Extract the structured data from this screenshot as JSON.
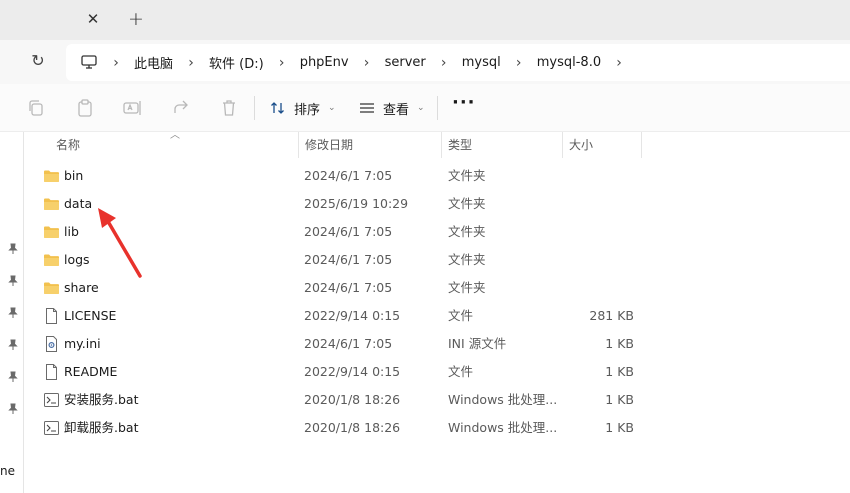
{
  "window": {
    "close_tab_glyph": "✕",
    "new_tab_glyph": "+"
  },
  "address_bar": {
    "refresh_glyph": "↻",
    "separator": "›",
    "crumbs": [
      "此电脑",
      "软件 (D:)",
      "phpEnv",
      "server",
      "mysql",
      "mysql-8.0"
    ]
  },
  "toolbar": {
    "sort_label": "排序",
    "view_label": "查看",
    "more_glyph": "···",
    "chevron": "⌄"
  },
  "nav_pane": {
    "partial_text": "ne"
  },
  "columns": {
    "name": "名称",
    "date": "修改日期",
    "type": "类型",
    "size": "大小"
  },
  "files": [
    {
      "icon": "folder-icon",
      "name": "bin",
      "date": "2024/6/1 7:05",
      "type": "文件夹",
      "size": ""
    },
    {
      "icon": "folder-icon",
      "name": "data",
      "date": "2025/6/19 10:29",
      "type": "文件夹",
      "size": ""
    },
    {
      "icon": "folder-icon",
      "name": "lib",
      "date": "2024/6/1 7:05",
      "type": "文件夹",
      "size": ""
    },
    {
      "icon": "folder-icon",
      "name": "logs",
      "date": "2024/6/1 7:05",
      "type": "文件夹",
      "size": ""
    },
    {
      "icon": "folder-icon",
      "name": "share",
      "date": "2024/6/1 7:05",
      "type": "文件夹",
      "size": ""
    },
    {
      "icon": "file-icon",
      "name": "LICENSE",
      "date": "2022/9/14 0:15",
      "type": "文件",
      "size": "281 KB"
    },
    {
      "icon": "ini-file-icon",
      "name": "my.ini",
      "date": "2024/6/1 7:05",
      "type": "INI 源文件",
      "size": "1 KB"
    },
    {
      "icon": "file-icon",
      "name": "README",
      "date": "2022/9/14 0:15",
      "type": "文件",
      "size": "1 KB"
    },
    {
      "icon": "batch-file-icon",
      "name": "安装服务.bat",
      "date": "2020/1/8 18:26",
      "type": "Windows 批处理...",
      "size": "1 KB"
    },
    {
      "icon": "batch-file-icon",
      "name": "卸载服务.bat",
      "date": "2020/1/8 18:26",
      "type": "Windows 批处理...",
      "size": "1 KB"
    }
  ],
  "colors": {
    "folder": "#f2c14e",
    "annotation_arrow": "#e8322c"
  }
}
